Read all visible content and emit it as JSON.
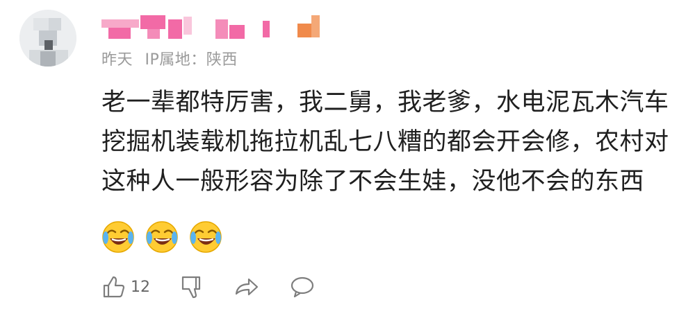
{
  "comment": {
    "username_blurred": true,
    "meta": {
      "time": "昨天",
      "ip_location": "IP属地：陕西"
    },
    "text_lines": [
      "老一辈都特厉害，我二舅，我老爹，水电泥瓦木汽车",
      "挖掘机装载机拖拉机乱七八糟的都会开会修，农村对",
      "这种人一般形容为除了不会生娃，没他不会的东西"
    ],
    "emojis": [
      "laugh-cry-icon",
      "laugh-cry-icon",
      "laugh-cry-icon"
    ],
    "actions": {
      "like_count": "12",
      "like_icon": "thumbs-up-icon",
      "dislike_icon": "thumbs-down-icon",
      "share_icon": "share-icon",
      "reply_icon": "comment-icon"
    }
  },
  "colors": {
    "username_pink": "#f26aa6",
    "username_orange": "#f08a4b",
    "meta_gray": "#9a9a9a",
    "text": "#1f1f1f",
    "icon_gray": "#7d7d7d"
  }
}
